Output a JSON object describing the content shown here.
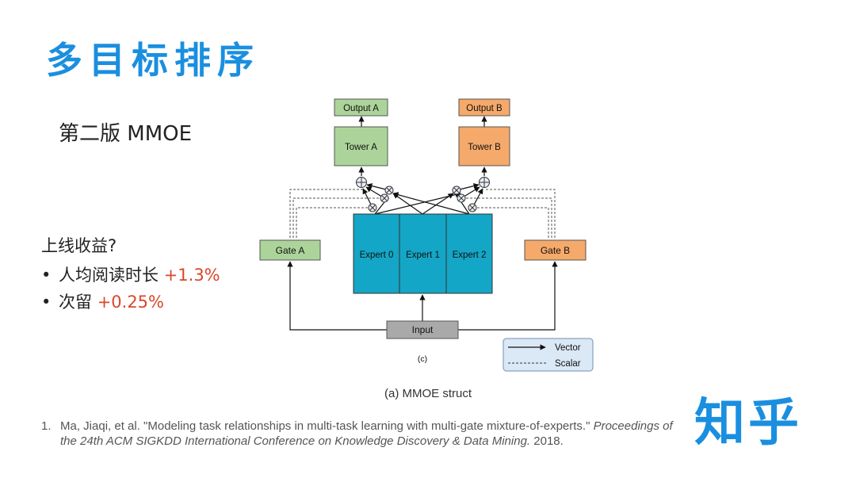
{
  "slide": {
    "title": "多目标排序",
    "subtitle": "第二版 MMOE",
    "gains_title": "上线收益?",
    "bullets": [
      {
        "label": "人均阅读时长 ",
        "value": "+1.3%"
      },
      {
        "label": "次留 ",
        "value": "+0.25%"
      }
    ],
    "caption": "(a) MMOE struct",
    "reference": {
      "number": "1.",
      "text_plain": "Ma, Jiaqi, et al. \"Modeling task relationships in multi-task learning with multi-gate mixture-of-experts.\" ",
      "text_italic": "Proceedings of the 24th ACM SIGKDD International Conference on Knowledge Discovery & Data Mining.",
      "year": " 2018."
    },
    "logo": "知乎"
  },
  "diagram": {
    "nodes": {
      "output_a": "Output A",
      "output_b": "Output B",
      "tower_a": "Tower A",
      "tower_b": "Tower B",
      "gate_a": "Gate A",
      "gate_b": "Gate B",
      "expert_0": "Expert 0",
      "expert_1": "Expert 1",
      "expert_2": "Expert 2",
      "input": "Input"
    },
    "panel_label": "(c)",
    "legend": {
      "vector": "Vector",
      "scalar": "Scalar"
    },
    "colors": {
      "task_a": "#acd49a",
      "task_b": "#f5a96a",
      "expert": "#14a6c6",
      "input": "#a9a9a9",
      "legend_bg": "#dbe8f5",
      "accent": "#1a8fe0",
      "gain": "#d9472b"
    }
  }
}
